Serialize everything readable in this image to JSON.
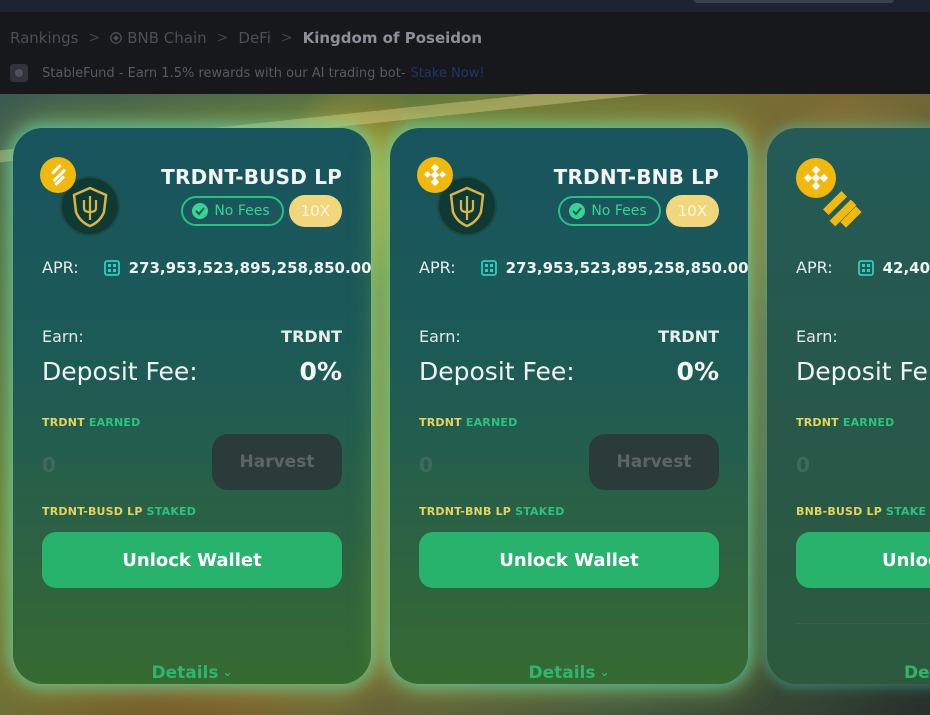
{
  "breadcrumb": {
    "items": [
      "Rankings",
      "BNB Chain",
      "DeFi"
    ],
    "current": "Kingdom of Poseidon",
    "separator": ">"
  },
  "promo": {
    "text": "StableFund - Earn 1.5% rewards with our AI trading bot-",
    "link": "Stake Now!"
  },
  "colors": {
    "accent_green": "#28b36c",
    "badge_yellow": "#f1d67b",
    "binance_yellow": "#f0b90b",
    "card_teal": "#18545d"
  },
  "farms": [
    {
      "pair": "TRDNT-BUSD LP",
      "fees_badge": "No Fees",
      "multiplier": "10X",
      "apr_label": "APR:",
      "apr_value": "273,953,523,895,258,850.00%",
      "earn_label": "Earn:",
      "earn_token": "TRDNT",
      "deposit_fee_label": "Deposit Fee:",
      "deposit_fee_value": "0%",
      "earned_token": "TRDNT",
      "earned_word": "EARNED",
      "earned_amount": "0",
      "harvest_label": "Harvest",
      "staked_token": "TRDNT-BUSD LP",
      "staked_word": "STAKED",
      "unlock_label": "Unlock Wallet",
      "details_label": "Details",
      "icons": [
        "bnb-coin-icon",
        "trident-shield-icon"
      ]
    },
    {
      "pair": "TRDNT-BNB LP",
      "fees_badge": "No Fees",
      "multiplier": "10X",
      "apr_label": "APR:",
      "apr_value": "273,953,523,895,258,850.00%",
      "earn_label": "Earn:",
      "earn_token": "TRDNT",
      "deposit_fee_label": "Deposit Fee:",
      "deposit_fee_value": "0%",
      "earned_token": "TRDNT",
      "earned_word": "EARNED",
      "earned_amount": "0",
      "harvest_label": "Harvest",
      "staked_token": "TRDNT-BNB LP",
      "staked_word": "STAKED",
      "unlock_label": "Unlock Wallet",
      "details_label": "Details",
      "icons": [
        "bnb-coin-icon",
        "trident-shield-icon"
      ]
    },
    {
      "apr_label": "APR:",
      "apr_value": "42,40",
      "earn_label": "Earn:",
      "deposit_fee_label": "Deposit Fe",
      "earned_token": "TRDNT",
      "earned_word": "EARNED",
      "earned_amount": "0",
      "staked_token": "BNB-BUSD LP",
      "staked_word": "STAKE",
      "unlock_label": "Unloc",
      "details_label": "Det",
      "icons": [
        "bnb-coin-icon",
        "busd-icon"
      ]
    }
  ]
}
